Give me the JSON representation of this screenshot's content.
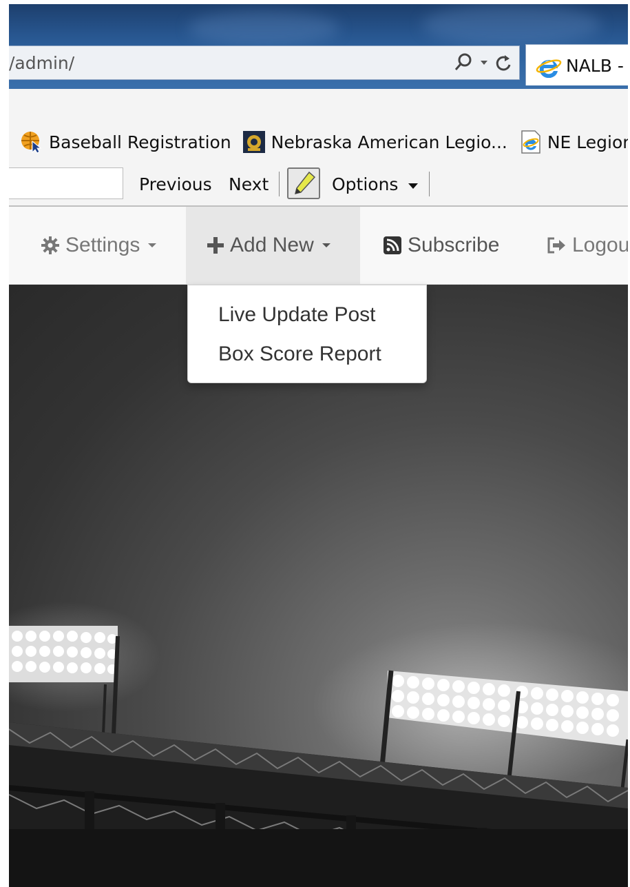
{
  "browser": {
    "address": "/admin/",
    "tab_title": "NALB - /"
  },
  "favorites": [
    {
      "label": "Baseball Registration",
      "icon": "globe-pointer-icon"
    },
    {
      "label": "Nebraska American Legio...",
      "icon": "legion-emblem-icon"
    },
    {
      "label": "NE Legion",
      "icon": "ie-page-icon"
    }
  ],
  "findbar": {
    "previous": "Previous",
    "next": "Next",
    "options": "Options"
  },
  "nav": {
    "settings": "Settings",
    "add_new": "Add New",
    "subscribe": "Subscribe",
    "logout": "Logou"
  },
  "add_new_menu": {
    "items": [
      "Live Update Post",
      "Box Score Report"
    ]
  },
  "colors": {
    "nav_background": "#f8f8f8",
    "nav_active": "#e7e7e7",
    "nav_text": "#777777",
    "titlebar_blue": "#2f64a0"
  }
}
